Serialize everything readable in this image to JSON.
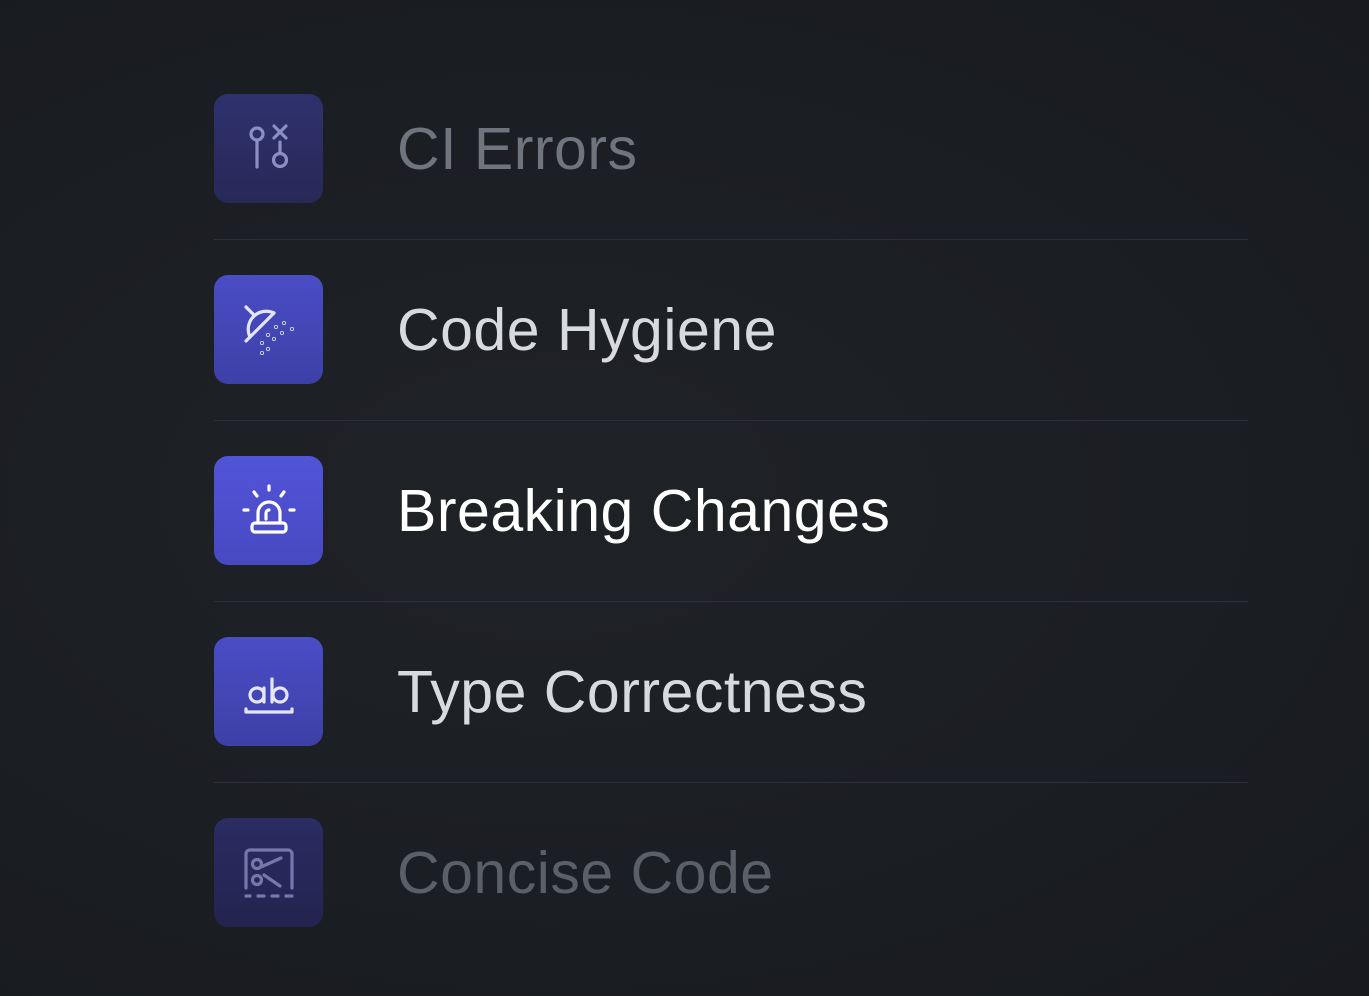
{
  "items": [
    {
      "label": "CI Errors",
      "icon": "git-compare-x-icon",
      "state": "dim"
    },
    {
      "label": "Code Hygiene",
      "icon": "shower-icon",
      "state": "mid"
    },
    {
      "label": "Breaking Changes",
      "icon": "siren-icon",
      "state": "active"
    },
    {
      "label": "Type Correctness",
      "icon": "text-ab-icon",
      "state": "mid"
    },
    {
      "label": "Concise Code",
      "icon": "scissors-square-icon",
      "state": "faded"
    }
  ],
  "colors": {
    "background": "#1b1e23",
    "accent": "#5254d8",
    "divider": "#2c2f36"
  }
}
